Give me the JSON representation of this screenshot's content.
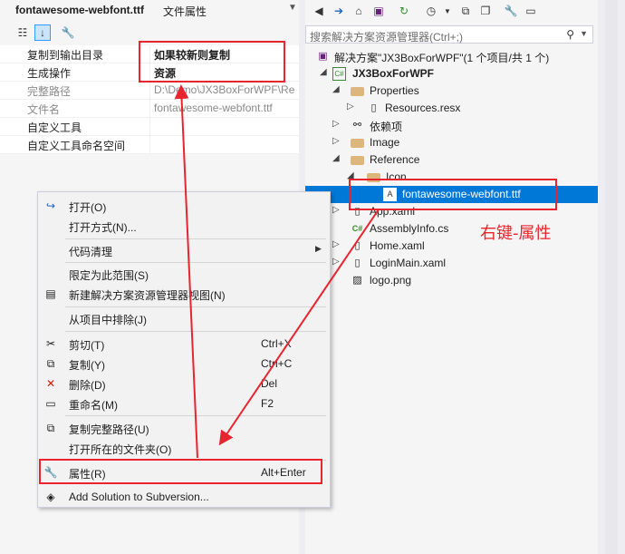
{
  "properties": {
    "title_name": "fontawesome-webfont.ttf",
    "title_kind": "文件属性",
    "rows": [
      {
        "key": "复制到输出目录",
        "value": "如果较新则复制",
        "bold": true,
        "dim": false
      },
      {
        "key": "生成操作",
        "value": "资源",
        "bold": true,
        "dim": false
      },
      {
        "key": "完整路径",
        "value": "D:\\Demo\\JX3BoxForWPF\\Re",
        "bold": false,
        "dim": true
      },
      {
        "key": "文件名",
        "value": "fontawesome-webfont.ttf",
        "bold": false,
        "dim": true
      },
      {
        "key": "自定义工具",
        "value": "",
        "bold": false,
        "dim": false
      },
      {
        "key": "自定义工具命名空间",
        "value": "",
        "bold": false,
        "dim": false
      }
    ]
  },
  "solution_explorer": {
    "search_placeholder": "搜索解决方案资源管理器(Ctrl+;)",
    "solution_label": "解决方案\"JX3BoxForWPF\"(1 个项目/共 1 个)",
    "project_label": "JX3BoxForWPF",
    "items": {
      "properties": "Properties",
      "resources": "Resources.resx",
      "deps": "依赖项",
      "image": "Image",
      "reference": "Reference",
      "icon": "Icon",
      "font": "fontawesome-webfont.ttf",
      "app": "App.xaml",
      "assemblyinfo": "AssemblyInfo.cs",
      "home": "Home.xaml",
      "loginmain": "LoginMain.xaml",
      "logo": "logo.png"
    }
  },
  "context_menu": {
    "open": "打开(O)",
    "open_with": "打开方式(N)...",
    "code_cleanup": "代码清理",
    "scope_to_this": "限定为此范围(S)",
    "new_view": "新建解决方案资源管理器视图(N)",
    "exclude": "从项目中排除(J)",
    "cut": "剪切(T)",
    "cut_key": "Ctrl+X",
    "copy": "复制(Y)",
    "copy_key": "Ctrl+C",
    "delete": "删除(D)",
    "delete_key": "Del",
    "rename": "重命名(M)",
    "rename_key": "F2",
    "copy_path": "复制完整路径(U)",
    "open_folder": "打开所在的文件夹(O)",
    "properties": "属性(R)",
    "properties_key": "Alt+Enter",
    "add_svn": "Add Solution to Subversion..."
  },
  "annotation": {
    "text": "右键-属性",
    "color": "#e8242e"
  },
  "colors": {
    "selection": "#0078d7",
    "accent_red": "#e8242e"
  }
}
